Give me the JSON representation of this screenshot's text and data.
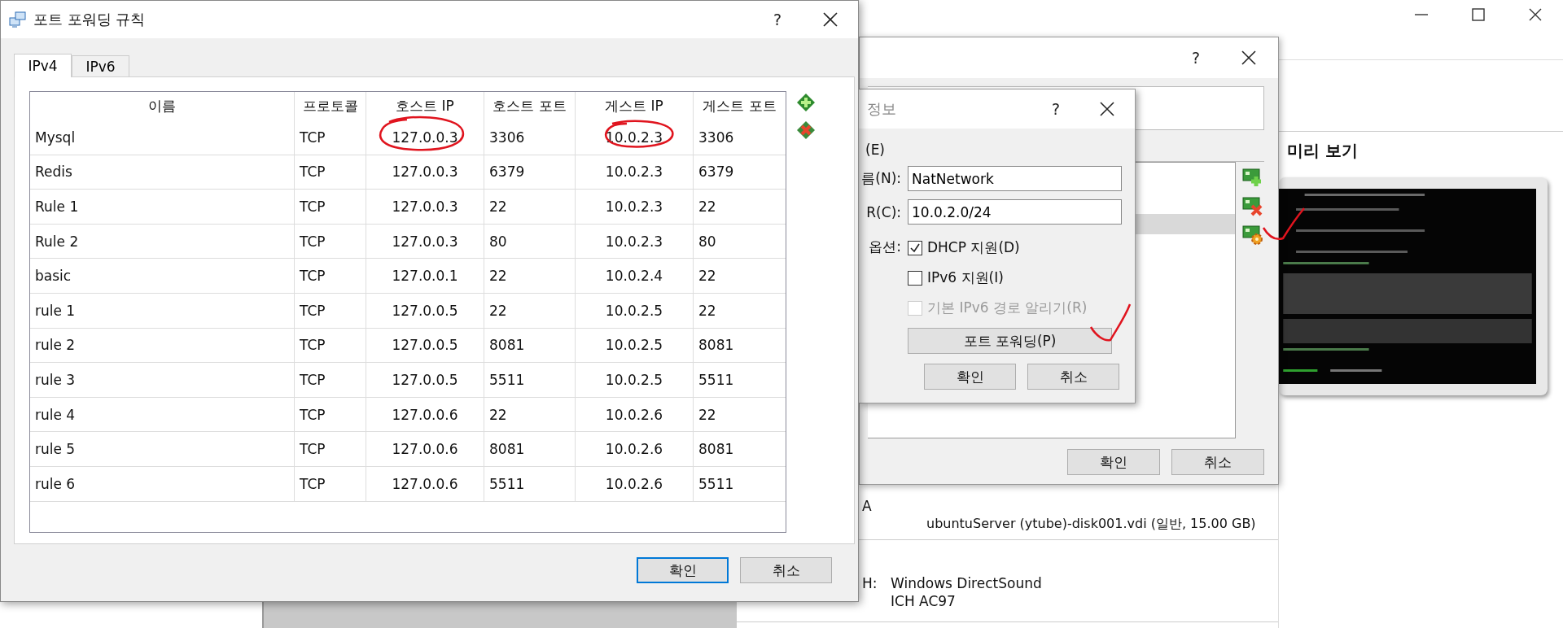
{
  "main_window": {
    "preview_heading": "미리 보기",
    "storage": {
      "label": "A",
      "disk": "ubuntuServer (ytube)-disk001.vdi (일반, 15.00 GB)"
    },
    "audio": {
      "label": "H:",
      "host_driver": "Windows DirectSound",
      "controller": "ICH AC97"
    }
  },
  "network_list_dialog": {
    "help": "?",
    "rows": [
      {
        "selected": false
      },
      {
        "selected": true
      }
    ],
    "tools": [
      {
        "kind": "add"
      },
      {
        "kind": "remove"
      },
      {
        "kind": "edit"
      }
    ],
    "buttons": [
      {
        "label": "확인",
        "default": false
      },
      {
        "label": "취소",
        "default": false
      }
    ]
  },
  "nat_dialog": {
    "title": "정보",
    "help": "?",
    "section_label": "(E)",
    "fields": [
      {
        "label": "름(N):",
        "value": "NatNetwork"
      },
      {
        "label": "R(C):",
        "value": "10.0.2.0/24"
      }
    ],
    "options_label": "옵션:",
    "options": [
      {
        "label": "DHCP 지원(D)",
        "checked": true,
        "disabled": false
      },
      {
        "label": "IPv6 지원(I)",
        "checked": false,
        "disabled": false
      },
      {
        "label": "기본 IPv6 경로 알리기(R)",
        "checked": false,
        "disabled": true
      }
    ],
    "port_forwarding_button": "포트 포워딩(P)",
    "buttons": [
      {
        "label": "확인",
        "default": false
      },
      {
        "label": "취소",
        "default": false
      }
    ]
  },
  "port_forwarding_dialog": {
    "title": "포트 포워딩 규칙",
    "help": "?",
    "tabs": [
      {
        "label": "IPv4",
        "selected": true
      },
      {
        "label": "IPv6",
        "selected": false
      }
    ],
    "columns": [
      "이름",
      "프로토콜",
      "호스트 IP",
      "호스트 포트",
      "게스트 IP",
      "게스트 포트"
    ],
    "rows": [
      [
        "Mysql",
        "TCP",
        "127.0.0.3",
        "3306",
        "10.0.2.3",
        "3306"
      ],
      [
        "Redis",
        "TCP",
        "127.0.0.3",
        "6379",
        "10.0.2.3",
        "6379"
      ],
      [
        "Rule 1",
        "TCP",
        "127.0.0.3",
        "22",
        "10.0.2.3",
        "22"
      ],
      [
        "Rule 2",
        "TCP",
        "127.0.0.3",
        "80",
        "10.0.2.3",
        "80"
      ],
      [
        "basic",
        "TCP",
        "127.0.0.1",
        "22",
        "10.0.2.4",
        "22"
      ],
      [
        "rule 1",
        "TCP",
        "127.0.0.5",
        "22",
        "10.0.2.5",
        "22"
      ],
      [
        "rule 2",
        "TCP",
        "127.0.0.5",
        "8081",
        "10.0.2.5",
        "8081"
      ],
      [
        "rule 3",
        "TCP",
        "127.0.0.5",
        "5511",
        "10.0.2.5",
        "5511"
      ],
      [
        "rule 4",
        "TCP",
        "127.0.0.6",
        "22",
        "10.0.2.6",
        "22"
      ],
      [
        "rule 5",
        "TCP",
        "127.0.0.6",
        "8081",
        "10.0.2.6",
        "8081"
      ],
      [
        "rule 6",
        "TCP",
        "127.0.0.6",
        "5511",
        "10.0.2.6",
        "5511"
      ]
    ],
    "tools": [
      {
        "kind": "add"
      },
      {
        "kind": "remove"
      }
    ],
    "buttons": [
      {
        "label": "확인",
        "default": true
      },
      {
        "label": "취소",
        "default": false
      }
    ]
  }
}
